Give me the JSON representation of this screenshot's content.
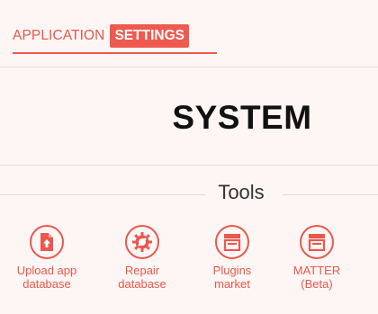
{
  "header": {
    "tabs": [
      {
        "label": "APPLICATION",
        "active": false
      },
      {
        "label": "SETTINGS",
        "active": true
      }
    ]
  },
  "main": {
    "title": "SYSTEM",
    "section_label": "Tools",
    "tools": [
      {
        "label_line1": "Upload app",
        "label_line2": "database",
        "icon": "upload-file-icon"
      },
      {
        "label_line1": "Repair",
        "label_line2": "database",
        "icon": "repair-gear-icon"
      },
      {
        "label_line1": "Plugins",
        "label_line2": "market",
        "icon": "store-icon"
      },
      {
        "label_line1": "MATTER",
        "label_line2": "(Beta)",
        "icon": "store-icon"
      }
    ]
  },
  "colors": {
    "accent": "#e8584d",
    "background": "#fdf6f4"
  }
}
